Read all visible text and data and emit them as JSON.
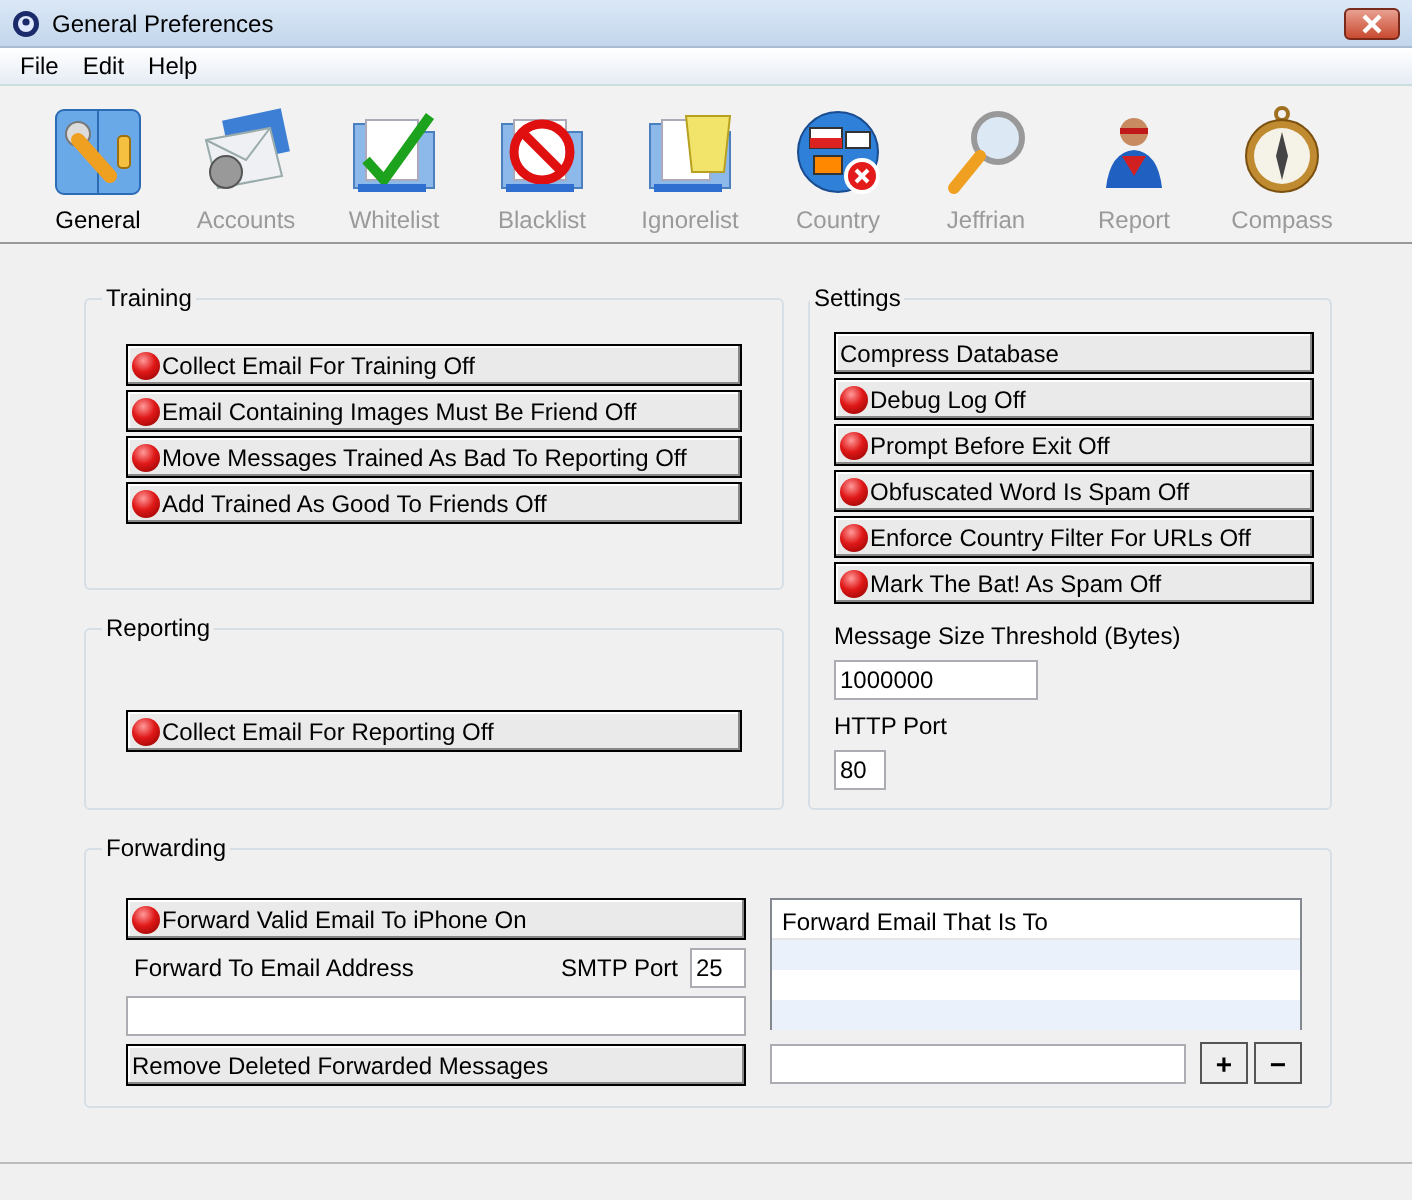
{
  "window": {
    "title": "General Preferences"
  },
  "menu": [
    "File",
    "Edit",
    "Help"
  ],
  "toolbar": [
    {
      "label": "General",
      "selected": true
    },
    {
      "label": "Accounts",
      "selected": false
    },
    {
      "label": "Whitelist",
      "selected": false
    },
    {
      "label": "Blacklist",
      "selected": false
    },
    {
      "label": "Ignorelist",
      "selected": false
    },
    {
      "label": "Country",
      "selected": false
    },
    {
      "label": "Jeffrian",
      "selected": false
    },
    {
      "label": "Report",
      "selected": false
    },
    {
      "label": "Compass",
      "selected": false
    }
  ],
  "training": {
    "title": "Training",
    "buttons": [
      {
        "kind": "toggle",
        "label": "Collect Email For Training Off"
      },
      {
        "kind": "toggle",
        "label": "Email Containing Images Must Be Friend Off"
      },
      {
        "kind": "toggle",
        "label": "Move Messages Trained As Bad To Reporting Off"
      },
      {
        "kind": "toggle",
        "label": "Add Trained As Good To Friends Off"
      }
    ]
  },
  "reporting": {
    "title": "Reporting",
    "buttons": [
      {
        "kind": "toggle",
        "label": "Collect Email For Reporting Off"
      }
    ]
  },
  "settings": {
    "title": "Settings",
    "buttons": [
      {
        "kind": "action",
        "label": "Compress Database"
      },
      {
        "kind": "toggle",
        "label": "Debug Log Off"
      },
      {
        "kind": "toggle",
        "label": "Prompt Before Exit Off"
      },
      {
        "kind": "toggle",
        "label": "Obfuscated Word Is Spam Off"
      },
      {
        "kind": "toggle",
        "label": "Enforce Country Filter For URLs Off"
      },
      {
        "kind": "toggle",
        "label": "Mark The Bat! As Spam Off"
      }
    ],
    "threshold": {
      "label": "Message Size Threshold (Bytes)",
      "value": "1000000"
    },
    "http_port": {
      "label": "HTTP Port",
      "value": "80"
    }
  },
  "forwarding": {
    "title": "Forwarding",
    "toggle": {
      "kind": "toggle",
      "label": "Forward Valid Email To iPhone On"
    },
    "address_label": "Forward To Email Address",
    "smtp_label": "SMTP Port",
    "smtp_value": "25",
    "remove_button": {
      "label": "Remove Deleted Forwarded Messages"
    },
    "list_header": "Forward Email That Is To",
    "add": "+",
    "remove": "−"
  }
}
